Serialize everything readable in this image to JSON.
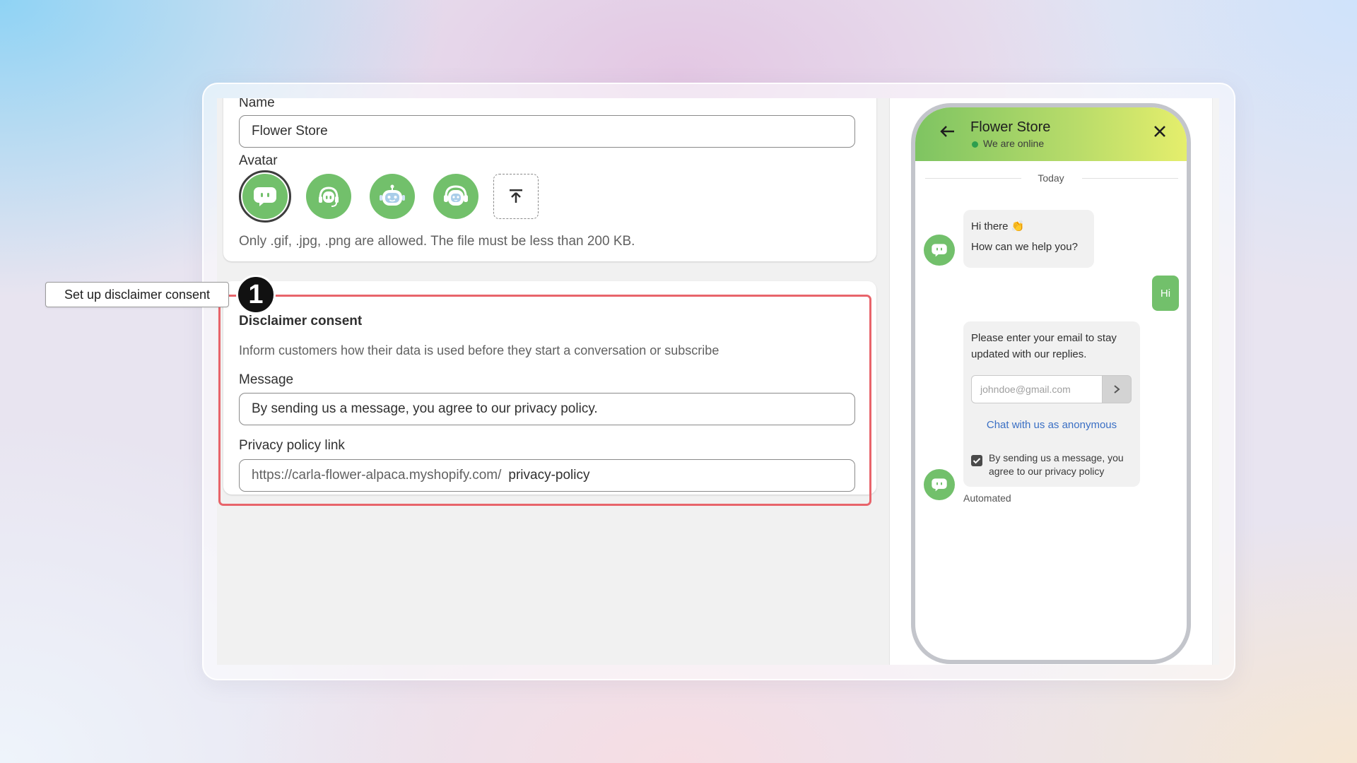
{
  "callout": {
    "label": "Set up disclaimer consent",
    "step": "1"
  },
  "form": {
    "name_label": "Name",
    "name_value": "Flower Store",
    "avatar_label": "Avatar",
    "avatar_options": [
      "chat-bubble-avatar",
      "headset-avatar",
      "robot-avatar",
      "robot-headset-avatar"
    ],
    "upload_icon": "upload-icon",
    "avatar_help": "Only .gif, .jpg, .png are allowed. The file must be less than 200 KB."
  },
  "disclaimer": {
    "title": "Disclaimer consent",
    "description": "Inform customers how their data is used before they start a conversation or subscribe",
    "message_label": "Message",
    "message_value": "By sending us a message, you agree to our privacy policy.",
    "privacy_label": "Privacy policy link",
    "privacy_prefix": "https://carla-flower-alpaca.myshopify.com/",
    "privacy_value": "privacy-policy",
    "highlight_color": "#e8646b"
  },
  "preview": {
    "store_name": "Flower Store",
    "status": "We are online",
    "date_divider": "Today",
    "greeting_line1": "Hi there 👏",
    "greeting_line2": "How can we help you?",
    "user_message": "Hi",
    "email_prompt": "Please enter your email to stay updated with our replies.",
    "email_placeholder": "johndoe@gmail.com",
    "anonymous_link": "Chat with us as anonymous",
    "consent_text": "By sending us a message, you agree to our privacy policy",
    "automated_label": "Automated",
    "brand_color": "#72c06b",
    "header_gradient": [
      "#7ec462",
      "#e5ee6c"
    ]
  }
}
